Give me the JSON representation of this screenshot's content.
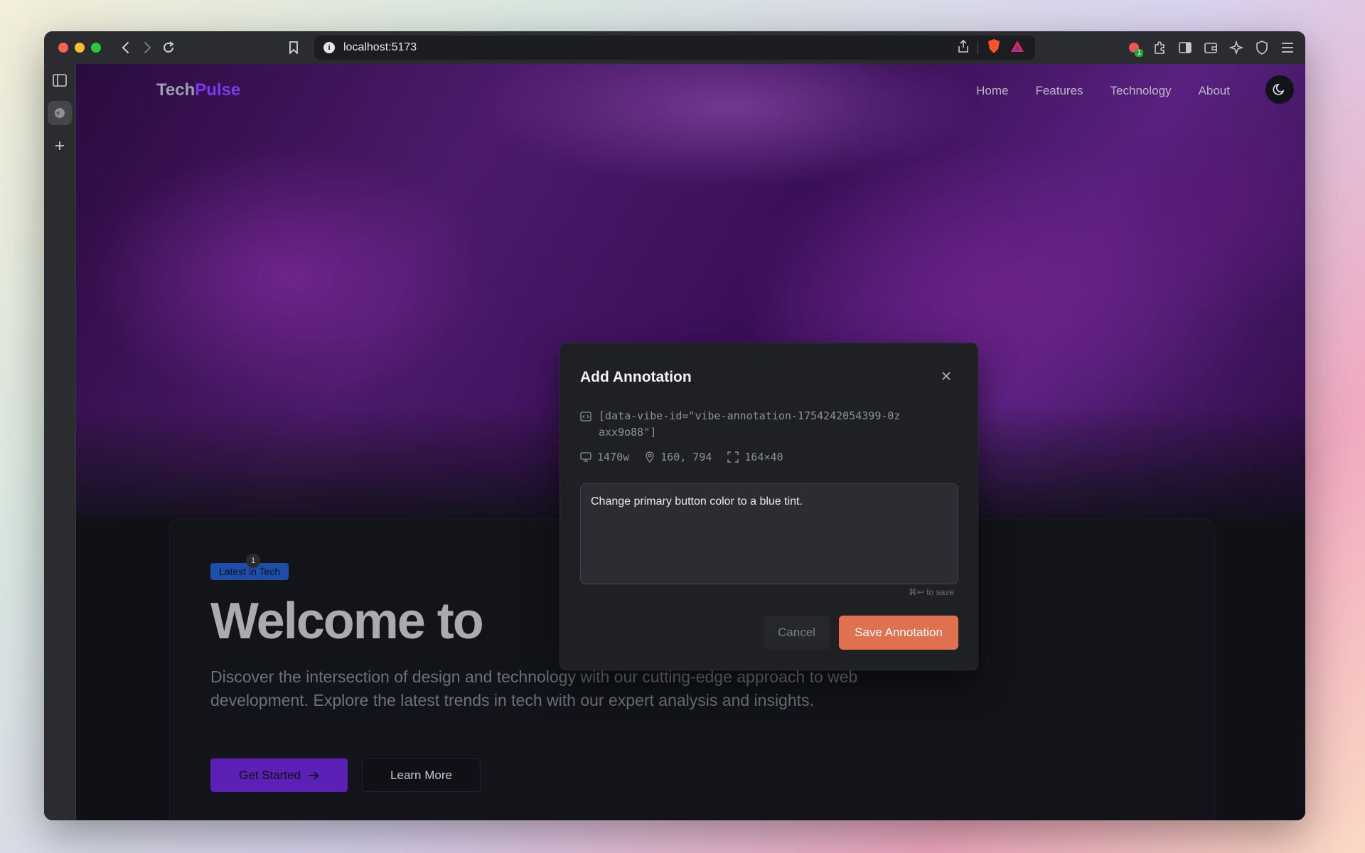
{
  "browser": {
    "url": "localhost:5173",
    "extension_badge": "1"
  },
  "site": {
    "logo_main": "Tech",
    "logo_accent": "Pulse",
    "nav": [
      "Home",
      "Features",
      "Technology",
      "About"
    ]
  },
  "hero": {
    "badge": "Latest in Tech",
    "badge_marker": "1",
    "title": "Welcome to",
    "description": "Discover the intersection of design and technology with our cutting-edge approach to web development. Explore the latest trends in tech with our expert analysis and insights.",
    "primary_label": "Get Started",
    "secondary_label": "Learn More"
  },
  "modal": {
    "title": "Add Annotation",
    "selector": "[data-vibe-id=\"vibe-annotation-1754242054399-0zaxx9o88\"]",
    "viewport_width": "1470w",
    "position": "160, 794",
    "size": "164×40",
    "note": "Change primary button color to a blue tint.",
    "hint": "⌘↩ to save",
    "cancel_label": "Cancel",
    "save_label": "Save Annotation"
  },
  "colors": {
    "accent": "#7c3aed",
    "save_button": "#e07150",
    "badge": "#1d4fa8"
  }
}
